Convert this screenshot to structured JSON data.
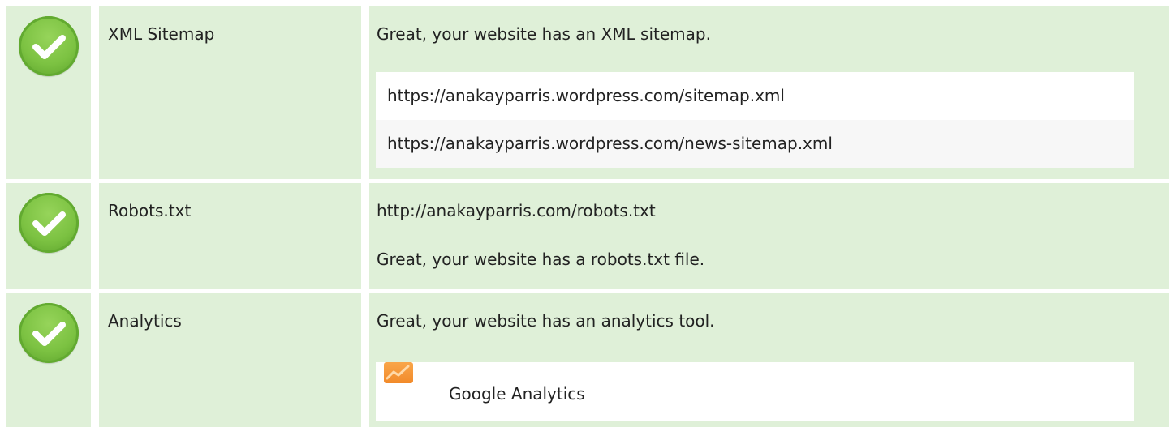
{
  "rows": [
    {
      "label": "XML Sitemap",
      "status_icon": "check-circle-icon",
      "message": "Great, your website has an XML sitemap.",
      "items": [
        "https://anakayparris.wordpress.com/sitemap.xml",
        "https://anakayparris.wordpress.com/news-sitemap.xml"
      ]
    },
    {
      "label": "Robots.txt",
      "status_icon": "check-circle-icon",
      "url": "http://anakayparris.com/robots.txt",
      "message": "Great, your website has a robots.txt file."
    },
    {
      "label": "Analytics",
      "status_icon": "check-circle-icon",
      "message": "Great, your website has an analytics tool.",
      "tools": [
        {
          "name": "Google Analytics",
          "icon": "google-analytics-icon"
        }
      ]
    }
  ],
  "colors": {
    "row_background": "#dff0d8",
    "check_green": "#7cc242",
    "list_odd": "#ffffff",
    "list_even": "#f7f7f7",
    "analytics_orange": "#f28a2a"
  }
}
